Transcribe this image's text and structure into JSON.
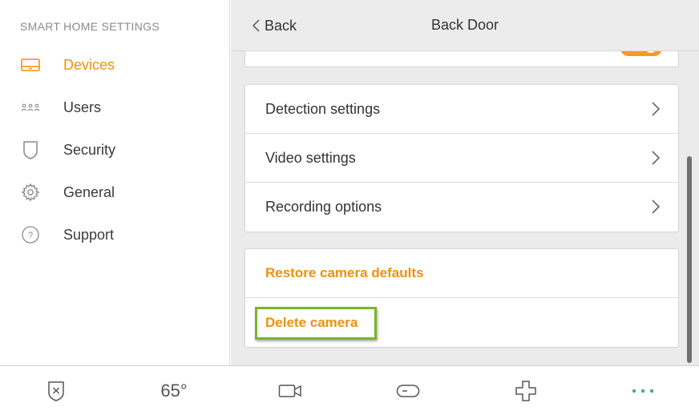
{
  "sidebar": {
    "heading": "SMART HOME SETTINGS",
    "items": [
      {
        "label": "Devices",
        "icon": "devices-icon",
        "active": true
      },
      {
        "label": "Users",
        "icon": "users-icon",
        "active": false
      },
      {
        "label": "Security",
        "icon": "shield-icon",
        "active": false
      },
      {
        "label": "General",
        "icon": "gear-icon",
        "active": false
      },
      {
        "label": "Support",
        "icon": "help-icon",
        "active": false
      }
    ]
  },
  "header": {
    "back_label": "Back",
    "title": "Back Door"
  },
  "settings_group": [
    {
      "label": "Detection settings"
    },
    {
      "label": "Video settings"
    },
    {
      "label": "Recording options"
    }
  ],
  "actions_group": [
    {
      "label": "Restore camera defaults"
    },
    {
      "label": "Delete camera"
    }
  ],
  "bottom_bar": {
    "temperature": "65°",
    "items": [
      "security-shield-icon",
      "temperature",
      "camera-icon",
      "remote-icon",
      "plus-icon",
      "more-icon"
    ]
  },
  "colors": {
    "accent": "#f0900a",
    "highlight": "#7ab526",
    "more_dots": "#3bb07a"
  }
}
